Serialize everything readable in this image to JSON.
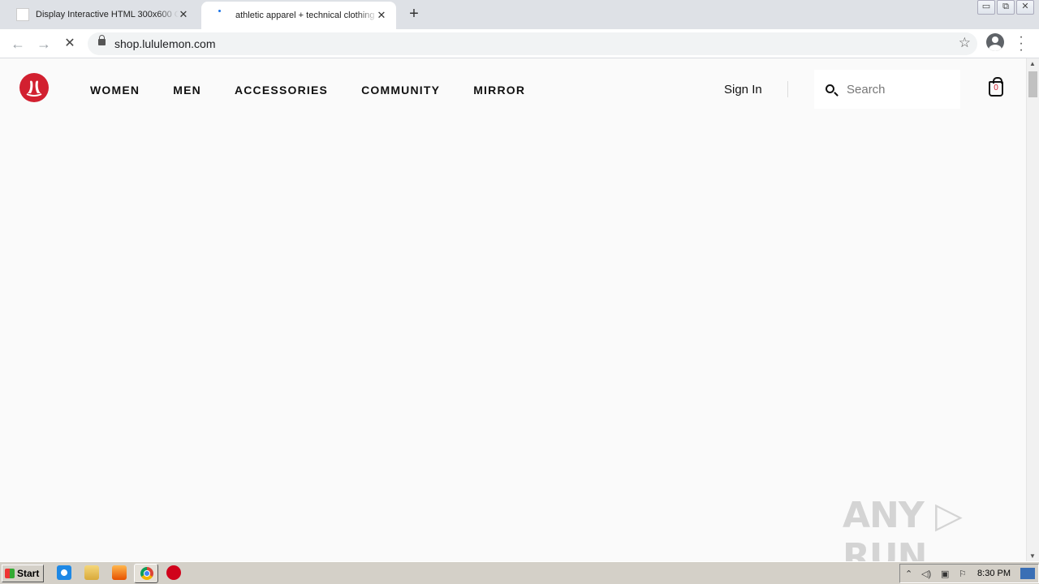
{
  "browser": {
    "tabs": [
      {
        "title": "Display Interactive HTML 300x600 C",
        "active": false
      },
      {
        "title": "athletic apparel + technical clothing",
        "active": true
      }
    ],
    "new_tab_label": "+",
    "close_glyph": "✕",
    "window_controls": [
      "▭",
      "⧉",
      "✕"
    ],
    "url": "shop.lululemon.com"
  },
  "site": {
    "brand_color": "#d22030",
    "nav": [
      "WOMEN",
      "MEN",
      "ACCESSORIES",
      "COMMUNITY",
      "MIRROR"
    ],
    "sign_in": "Sign In",
    "search_placeholder": "Search",
    "bag_count": "0"
  },
  "watermark": "ANY ▷ RUN",
  "taskbar": {
    "start_label": "Start",
    "time": "8:30 PM"
  }
}
